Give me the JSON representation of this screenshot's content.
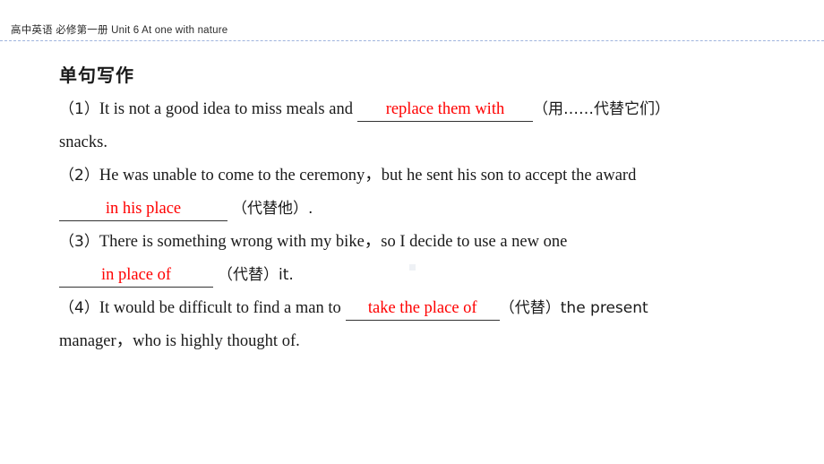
{
  "header": {
    "title": "高中英语  必修第一册   Unit 6  At one with nature"
  },
  "section": {
    "title": "单句写作"
  },
  "questions": [
    {
      "number": "（1）",
      "line1_before": "It is not a good idea to miss meals and",
      "answer": "replace them with",
      "line1_after": "（用……代替它们）",
      "line2": "snacks."
    },
    {
      "number": "（2）",
      "line1": "He was unable to come to the ceremony，but he sent his son to accept the award",
      "answer": "in his place",
      "line2_after": "（代替他）."
    },
    {
      "number": "（3）",
      "line1": "There is something wrong with my bike，so I decide to use a new one",
      "answer": "in place of",
      "line2_after": "（代替）it."
    },
    {
      "number": "（4）",
      "line1_before": "It would be difficult to find a man to",
      "answer": "take the place of",
      "line1_after": "（代替）the present",
      "line2": "manager，who is highly thought of."
    }
  ],
  "colors": {
    "answer_red": "#ff0000",
    "header_rule": "#8fa8d8",
    "text": "#1a1a1a"
  }
}
